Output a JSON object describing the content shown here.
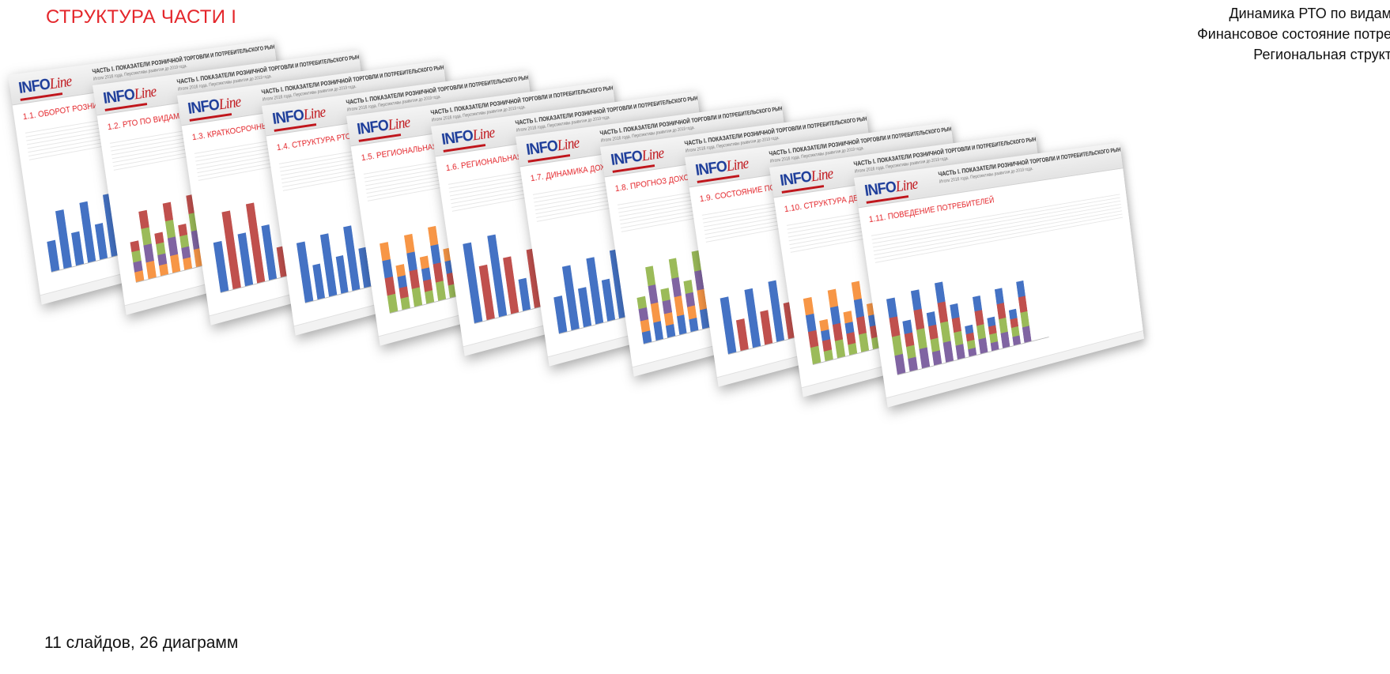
{
  "header": {
    "title": "СТРУКТУРА ЧАСТИ I"
  },
  "right_list": [
    "Динамика РТО по видам",
    "Финансовое состояние потре",
    "Региональная структ"
  ],
  "caption": "11 слайдов, 26 диаграмм",
  "slides": [
    {
      "head": "ЧАСТЬ I. ПОКАЗАТЕЛИ РОЗНИЧНОЙ ТОРГОВЛИ И ПОТРЕБИТЕЛЬСКОГО РЫНКА",
      "sub": "Итоги 2016 года. Перспективы развития до 2019 года.",
      "title": "1.1. ОБОРОТ РОЗНИЧНОЙ ТОРГОВЛИ"
    },
    {
      "head": "ЧАСТЬ I. ПОКАЗАТЕЛИ РОЗНИЧНОЙ ТОРГОВЛИ И ПОТРЕБИТЕЛЬСКОГО РЫНКА",
      "sub": "Итоги 2016 года. Перспективы развития до 2019 года.",
      "title": "1.2. РТО ПО ВИДАМ ТОВАРОВ"
    },
    {
      "head": "ЧАСТЬ I. ПОКАЗАТЕЛИ РОЗНИЧНОЙ ТОРГОВЛИ И ПОТРЕБИТЕЛЬСКОГО РЫНКА",
      "sub": "Итоги 2016 года. Перспективы развития до 2019 года.",
      "title": "1.3. КРАТКОСРОЧНЫЙ ПРОГНОЗ ОБОРОТА РОЗНИЧНОЙ ТОРГОВЛИ"
    },
    {
      "head": "ЧАСТЬ I. ПОКАЗАТЕЛИ РОЗНИЧНОЙ ТОРГОВЛИ И ПОТРЕБИТЕЛЬСКОГО РЫНКА",
      "sub": "Итоги 2016 года. Перспективы развития до 2019 года.",
      "title": "1.4. СТРУКТУРА РТО"
    },
    {
      "head": "ЧАСТЬ I. ПОКАЗАТЕЛИ РОЗНИЧНОЙ ТОРГОВЛИ И ПОТРЕБИТЕЛЬСКОГО РЫНКА",
      "sub": "Итоги 2016 года. Перспективы развития до 2019 года.",
      "title": "1.5. РЕГИОНАЛЬНАЯ СТ"
    },
    {
      "head": "ЧАСТЬ I. ПОКАЗАТЕЛИ РОЗНИЧНОЙ ТОРГОВЛИ И ПОТРЕБИТЕЛЬСКОГО РЫНКА",
      "sub": "Итоги 2016 года. Перспективы развития до 2019 года.",
      "title": "1.6. РЕГИОНАЛЬНАЯ СТ"
    },
    {
      "head": "ЧАСТЬ I. ПОКАЗАТЕЛИ РОЗНИЧНОЙ ТОРГОВЛИ И ПОТРЕБИТЕЛЬСКОГО РЫНКА",
      "sub": "Итоги 2016 года. Перспективы развития до 2019 года.",
      "title": "1.7. ДИНАМИКА ДОХОД"
    },
    {
      "head": "ЧАСТЬ I. ПОКАЗАТЕЛИ РОЗНИЧНОЙ ТОРГОВЛИ И ПОТРЕБИТЕЛЬСКОГО РЫНКА",
      "sub": "Итоги 2016 года. Перспективы развития до 2019 года.",
      "title": "1.8. ПРОГНОЗ ДОХОДОВ И"
    },
    {
      "head": "ЧАСТЬ I. ПОКАЗАТЕЛИ РОЗНИЧНОЙ ТОРГОВЛИ И ПОТРЕБИТЕЛЬСКОГО РЫНКА",
      "sub": "Итоги 2016 года. Перспективы развития до 2019 года.",
      "title": "1.9. СОСТОЯНИЕ ПОТРЕБИТЕЛЬСКОГО КРЕДИТОВАНИЯ И ДЕПОЗИТЫ"
    },
    {
      "head": "ЧАСТЬ I. ПОКАЗАТЕЛИ РОЗНИЧНОЙ ТОРГОВЛИ И ПОТРЕБИТЕЛЬСКОГО РЫНКА",
      "sub": "Итоги 2016 года. Перспективы развития до 2019 года.",
      "title": "1.10. СТРУКТУРА ДЕНЕЖНЫХ ДОХОДОВ И РАСХОДОВ НАСЕЛЕНИЯ"
    },
    {
      "head": "ЧАСТЬ I. ПОКАЗАТЕЛИ РОЗНИЧНОЙ ТОРГОВЛИ И ПОТРЕБИТЕЛЬСКОГО РЫНКА",
      "sub": "Итоги 2016 года. Перспективы развития до 2019 года.",
      "title": "1.11. ПОВЕДЕНИЕ ПОТРЕБИТЕЛЕЙ"
    }
  ],
  "logo": {
    "text": "INFO",
    "script": "Line"
  },
  "colors": {
    "accent": "#e4262b",
    "logo_blue": "#1d3d9a",
    "bar_blue": "#4472c4",
    "bar_red": "#c0504d",
    "bar_green": "#9bbb59",
    "bar_purple": "#8064a2",
    "bar_orange": "#f79646"
  }
}
